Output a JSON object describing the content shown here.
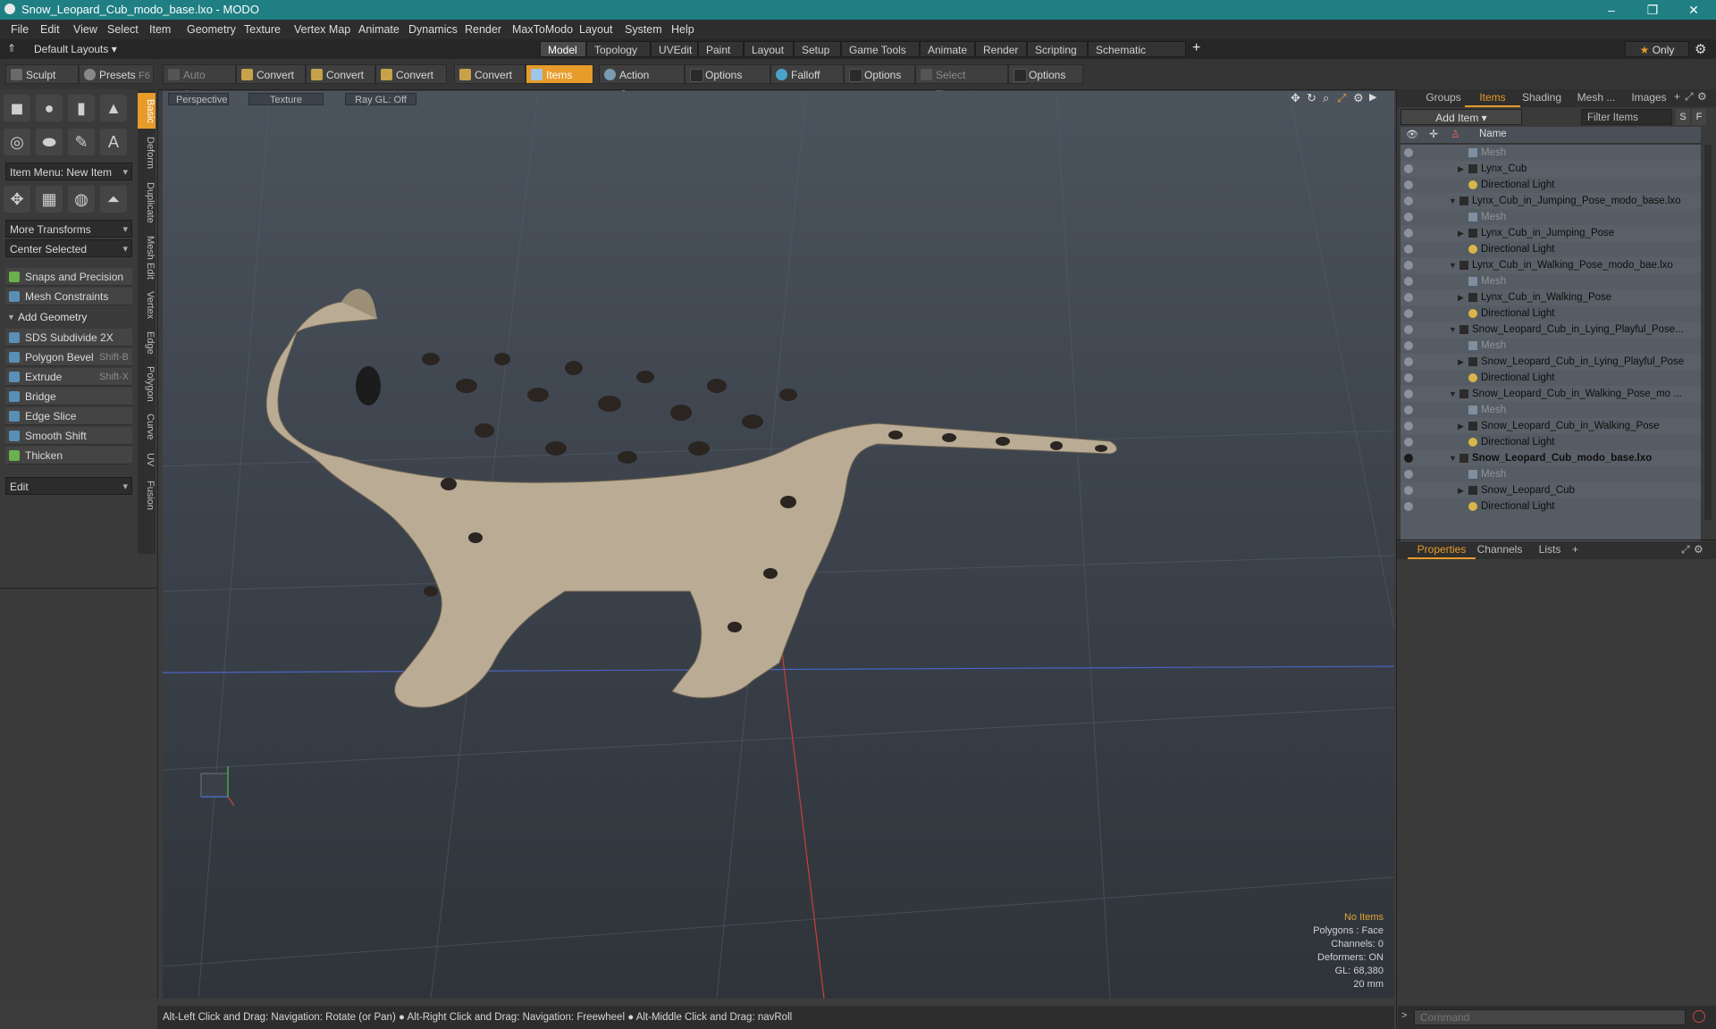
{
  "window": {
    "title": "Snow_Leopard_Cub_modo_base.lxo - MODO",
    "minimize": "–",
    "maximize": "❐",
    "close": "✕"
  },
  "menu": [
    "File",
    "Edit",
    "View",
    "Select",
    "Item",
    "Geometry",
    "Texture",
    "Vertex Map",
    "Animate",
    "Dynamics",
    "Render",
    "MaxToModo",
    "Layout",
    "System",
    "Help"
  ],
  "layoutbar": {
    "layout_dropdown": "Default Layouts",
    "tabs": [
      "Model",
      "Topology",
      "UVEdit",
      "Paint",
      "Layout",
      "Setup",
      "Game Tools",
      "Animate",
      "Render",
      "Scripting",
      "Schematic Fusion"
    ],
    "active_tab": "Model",
    "add": "+",
    "only": "Only",
    "star": "★"
  },
  "toolbar": {
    "sculpt": "Sculpt",
    "presets": "Presets",
    "presets_key": "F6",
    "auto_select": "Auto Select",
    "convert1": "Convert",
    "convert2": "Convert",
    "convert3": "Convert",
    "convert4": "Convert",
    "items": "Items",
    "action_center": "Action Center",
    "options1": "Options",
    "falloff": "Falloff",
    "options2": "Options",
    "select_through": "Select Through",
    "options3": "Options"
  },
  "left": {
    "vtabs": [
      "Basic",
      "Deform",
      "Duplicate",
      "Mesh Edit",
      "Vertex",
      "Edge",
      "Polygon",
      "Curve",
      "UV",
      "Fusion"
    ],
    "item_menu": "Item Menu: New Item",
    "more_transforms": "More Transforms",
    "center_selected": "Center Selected",
    "snaps": "Snaps and Precision",
    "mesh_constraints": "Mesh Constraints",
    "add_geometry": "Add Geometry",
    "tools": [
      {
        "label": "SDS Subdivide 2X",
        "shortcut": ""
      },
      {
        "label": "Polygon Bevel",
        "shortcut": "Shift-B"
      },
      {
        "label": "Extrude",
        "shortcut": "Shift-X"
      },
      {
        "label": "Bridge",
        "shortcut": ""
      },
      {
        "label": "Edge Slice",
        "shortcut": ""
      },
      {
        "label": "Smooth Shift",
        "shortcut": ""
      },
      {
        "label": "Thicken",
        "shortcut": ""
      }
    ],
    "edit": "Edit"
  },
  "viewport": {
    "view": "Perspective",
    "shading": "Texture",
    "raygl": "Ray GL: Off",
    "info": {
      "no_items": "No Items",
      "polygons": "Polygons : Face",
      "channels": "Channels: 0",
      "deformers": "Deformers: ON",
      "gl": "GL: 68,380",
      "scale": "20 mm"
    }
  },
  "right": {
    "tabs": [
      "Groups",
      "Items",
      "Shading",
      "Mesh ...",
      "Images"
    ],
    "active_tab": "Items",
    "add_item": "Add Item",
    "filter": "Filter Items",
    "s": "S",
    "f": "F",
    "name_col": "Name",
    "items": [
      {
        "label": "Mesh",
        "level": 2,
        "kind": "mesh",
        "dim": true
      },
      {
        "label": "Lynx_Cub",
        "level": 2,
        "kind": "group",
        "expand": "▶"
      },
      {
        "label": "Directional Light",
        "level": 2,
        "kind": "light"
      },
      {
        "label": "Lynx_Cub_in_Jumping_Pose_modo_base.lxo",
        "level": 1,
        "kind": "scene",
        "expand": "▼"
      },
      {
        "label": "Mesh",
        "level": 2,
        "kind": "mesh",
        "dim": true
      },
      {
        "label": "Lynx_Cub_in_Jumping_Pose",
        "level": 2,
        "kind": "group",
        "expand": "▶"
      },
      {
        "label": "Directional Light",
        "level": 2,
        "kind": "light"
      },
      {
        "label": "Lynx_Cub_in_Walking_Pose_modo_bae.lxo",
        "level": 1,
        "kind": "scene",
        "expand": "▼"
      },
      {
        "label": "Mesh",
        "level": 2,
        "kind": "mesh",
        "dim": true
      },
      {
        "label": "Lynx_Cub_in_Walking_Pose",
        "level": 2,
        "kind": "group",
        "expand": "▶"
      },
      {
        "label": "Directional Light",
        "level": 2,
        "kind": "light"
      },
      {
        "label": "Snow_Leopard_Cub_in_Lying_Playful_Pose...",
        "level": 1,
        "kind": "scene",
        "expand": "▼"
      },
      {
        "label": "Mesh",
        "level": 2,
        "kind": "mesh",
        "dim": true
      },
      {
        "label": "Snow_Leopard_Cub_in_Lying_Playful_Pose",
        "level": 2,
        "kind": "group",
        "expand": "▶"
      },
      {
        "label": "Directional Light",
        "level": 2,
        "kind": "light"
      },
      {
        "label": "Snow_Leopard_Cub_in_Walking_Pose_mo ...",
        "level": 1,
        "kind": "scene",
        "expand": "▼"
      },
      {
        "label": "Mesh",
        "level": 2,
        "kind": "mesh",
        "dim": true
      },
      {
        "label": "Snow_Leopard_Cub_in_Walking_Pose",
        "level": 2,
        "kind": "group",
        "expand": "▶"
      },
      {
        "label": "Directional Light",
        "level": 2,
        "kind": "light"
      },
      {
        "label": "Snow_Leopard_Cub_modo_base.lxo",
        "level": 1,
        "kind": "scene",
        "expand": "▼",
        "bold": true
      },
      {
        "label": "Mesh",
        "level": 2,
        "kind": "mesh",
        "dim": true
      },
      {
        "label": "Snow_Leopard_Cub",
        "level": 2,
        "kind": "group",
        "expand": "▶"
      },
      {
        "label": "Directional Light",
        "level": 2,
        "kind": "light"
      }
    ],
    "bottom_tabs": [
      "Properties",
      "Channels",
      "Lists"
    ],
    "bottom_active": "Properties",
    "bottom_add": "+"
  },
  "status": "Alt-Left Click and Drag: Navigation: Rotate (or Pan) ● Alt-Right Click and Drag: Navigation: Freewheel ● Alt-Middle Click and Drag: navRoll",
  "command": {
    "placeholder": "Command"
  },
  "colors": {
    "accent": "#e79b2a",
    "titlebar": "#1f7f83"
  }
}
